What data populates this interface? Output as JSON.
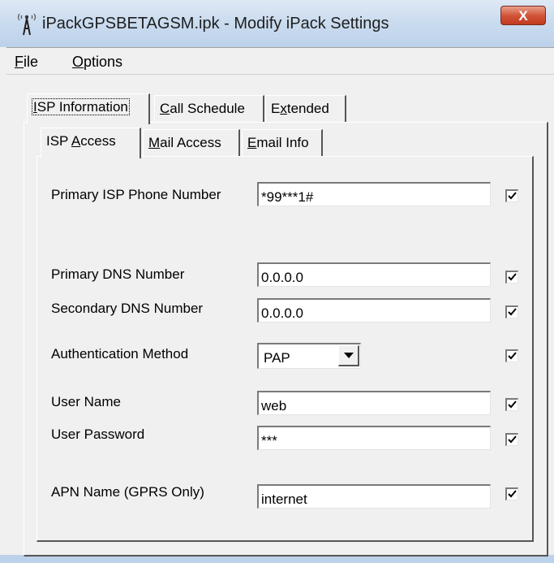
{
  "window": {
    "title": "iPackGPSBETAGSM.ipk - Modify iPack Settings",
    "close_label": "X",
    "app_icon": "antenna-icon"
  },
  "menu": {
    "file": {
      "hotkey": "F",
      "rest": "ile"
    },
    "options": {
      "hotkey": "O",
      "rest": "ptions"
    }
  },
  "top_tabs": [
    {
      "hotkey": "I",
      "rest": "SP Information",
      "active": true
    },
    {
      "hotkey": "C",
      "rest": "all Schedule",
      "active": false
    },
    {
      "pre": "E",
      "hotkey": "x",
      "rest": "tended",
      "active": false
    }
  ],
  "sub_tabs": [
    {
      "pre": "ISP ",
      "hotkey": "A",
      "rest": "ccess",
      "active": true
    },
    {
      "hotkey": "M",
      "rest": "ail Access",
      "active": false
    },
    {
      "hotkey": "E",
      "rest": "mail Info",
      "active": false
    }
  ],
  "fields": {
    "primary_isp_phone": {
      "label": "Primary ISP Phone Number",
      "value": "*99***1#",
      "checked": true
    },
    "primary_dns": {
      "label": "Primary DNS Number",
      "value": "0.0.0.0",
      "checked": true
    },
    "secondary_dns": {
      "label": "Secondary DNS Number",
      "value": "0.0.0.0",
      "checked": true
    },
    "auth_method": {
      "label": "Authentication Method",
      "value": "PAP",
      "checked": true
    },
    "user_name": {
      "label": "User Name",
      "value": "web",
      "checked": true
    },
    "user_password": {
      "label": "User Password",
      "value": "***",
      "checked": true
    },
    "apn_name": {
      "label": "APN Name (GPRS Only)",
      "value": "internet",
      "checked": true
    }
  },
  "colors": {
    "title_bar": "#cbdcef",
    "close_button": "#c23a1f",
    "dialog_face": "#f0f0f0"
  }
}
